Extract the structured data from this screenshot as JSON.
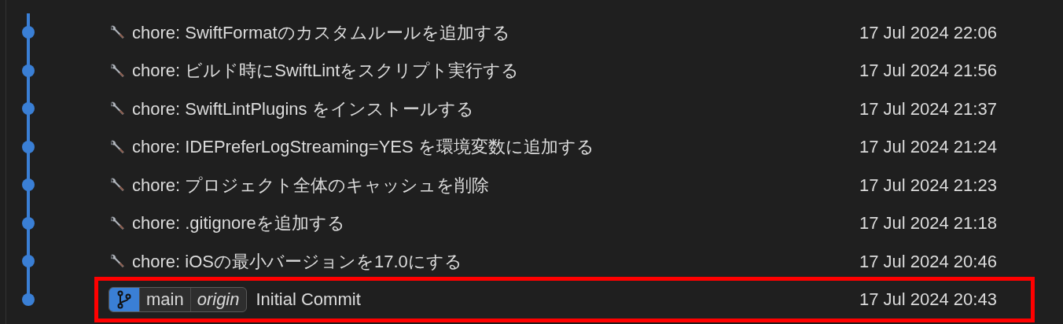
{
  "commits": [
    {
      "kind": "chore",
      "message": "chore: SwiftFormatのカスタムルールを追加する",
      "date": "17 Jul 2024 22:06",
      "highlighted": false
    },
    {
      "kind": "chore",
      "message": "chore: ビルド時にSwiftLintをスクリプト実行する",
      "date": "17 Jul 2024 21:56",
      "highlighted": false
    },
    {
      "kind": "chore",
      "message": "chore: SwiftLintPlugins をインストールする",
      "date": "17 Jul 2024 21:37",
      "highlighted": false
    },
    {
      "kind": "chore",
      "message": "chore: IDEPreferLogStreaming=YES を環境変数に追加する",
      "date": "17 Jul 2024 21:24",
      "highlighted": false
    },
    {
      "kind": "chore",
      "message": "chore: プロジェクト全体のキャッシュを削除",
      "date": "17 Jul 2024 21:23",
      "highlighted": false
    },
    {
      "kind": "chore",
      "message": "chore: .gitignoreを追加する",
      "date": "17 Jul 2024 21:18",
      "highlighted": false
    },
    {
      "kind": "chore",
      "message": "chore: iOSの最小バージョンを17.0にする",
      "date": "17 Jul 2024 20:46",
      "highlighted": false
    },
    {
      "kind": "branch",
      "refs": [
        {
          "label": "main",
          "kind": "local"
        },
        {
          "label": "origin",
          "kind": "remote"
        }
      ],
      "message": "Initial Commit",
      "date": "17 Jul 2024 20:43",
      "highlighted": true
    }
  ]
}
